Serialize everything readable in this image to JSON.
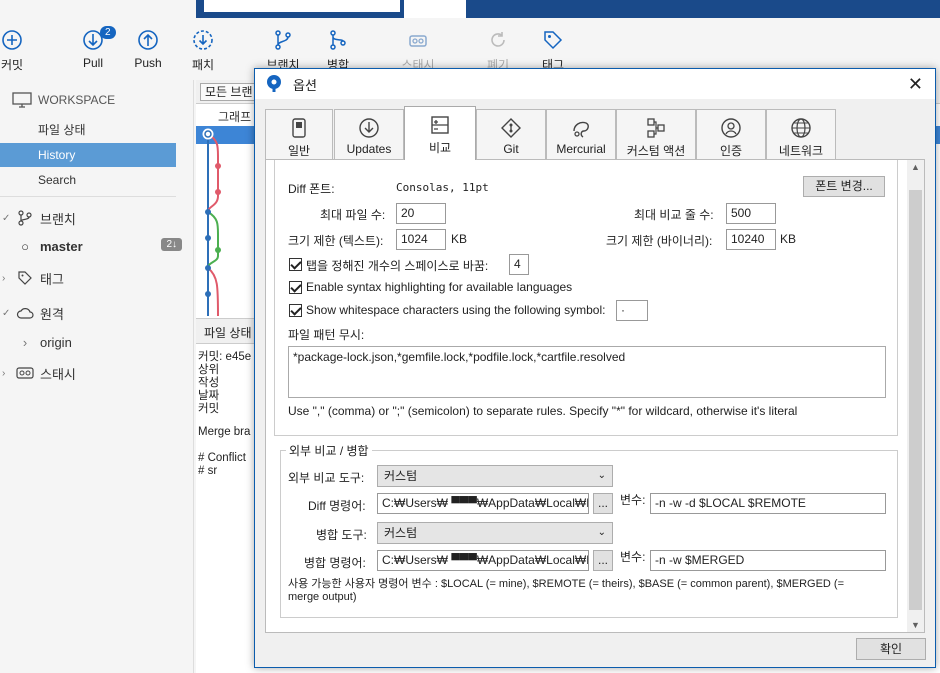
{
  "toolbar": {
    "commit": "커밋",
    "pull": "Pull",
    "pull_badge": "2",
    "push": "Push",
    "fetch": "패치",
    "branch": "브랜치",
    "merge": "병합",
    "stash": "스태시",
    "discard": "폐기",
    "tag": "태그"
  },
  "sidebar": {
    "workspace": "WORKSPACE",
    "items": [
      {
        "label": "파일 상태"
      },
      {
        "label": "History"
      },
      {
        "label": "Search"
      }
    ],
    "branches": "브랜치",
    "master": "master",
    "master_badge": "2↓",
    "tags": "태그",
    "remotes": "원격",
    "origin": "origin",
    "stashes": "스태시"
  },
  "main": {
    "filter_button": "모든 브랜",
    "graph_header": "그래프",
    "lower_tab": "파일 상태",
    "commit_line": "커밋: e45e",
    "parent_line": "상위",
    "author_line": "작성",
    "date_line": "날짜",
    "committer_line": "커밋",
    "merge_text": "Merge bra",
    "conflict_text": "# Conflict",
    "conflict_file": "#      sr"
  },
  "dialog": {
    "title": "옵션",
    "close": "✕",
    "tabs": [
      {
        "label": "일반"
      },
      {
        "label": "Updates"
      },
      {
        "label": "비교"
      },
      {
        "label": "Git"
      },
      {
        "label": "Mercurial"
      },
      {
        "label": "커스텀 액션"
      },
      {
        "label": "인증"
      },
      {
        "label": "네트워크"
      }
    ],
    "diff": {
      "font_label": "Diff 폰트:",
      "font_value": "Consolas, 11pt",
      "font_button": "폰트 변경...",
      "max_files_label": "최대 파일 수:",
      "max_files_value": "20",
      "max_lines_label": "최대 비교 줄 수:",
      "max_lines_value": "500",
      "size_text_label": "크기 제한 (텍스트):",
      "size_text_value": "1024",
      "size_text_unit": "KB",
      "size_bin_label": "크기 제한 (바이너리):",
      "size_bin_value": "10240",
      "size_bin_unit": "KB",
      "tabs_spaces_label": "탭을 정해진 개수의 스페이스로 바꿈:",
      "tabs_spaces_value": "4",
      "syntax_label": "Enable syntax highlighting for available languages",
      "whitespace_label": "Show whitespace characters using the following symbol:",
      "whitespace_value": "·",
      "ignore_label": "파일 패턴 무시:",
      "ignore_value": "*package-lock.json,*gemfile.lock,*podfile.lock,*cartfile.resolved",
      "ignore_hint": "Use \",\" (comma) or \";\" (semicolon) to separate rules. Specify \"*\" for wildcard, otherwise it's literal"
    },
    "external": {
      "group_title": "외부 비교 / 병합",
      "diff_tool_label": "외부 비교 도구:",
      "diff_tool_value": "커스텀",
      "diff_cmd_label": "Diff 명령어:",
      "diff_cmd_value": "C:₩Users₩ ▀▀▀₩AppData₩Local₩Pro",
      "diff_args_label": "변수:",
      "diff_args_value": "-n -w -d $LOCAL $REMOTE",
      "merge_tool_label": "병합 도구:",
      "merge_tool_value": "커스텀",
      "merge_cmd_label": "병합 명령어:",
      "merge_cmd_value": "C:₩Users₩ ▀▀▀₩AppData₩Local₩Pro",
      "merge_args_label": "변수:",
      "merge_args_value": "-n -w $MERGED",
      "browse": "...",
      "vars_hint": "사용 가능한 사용자 명령어 변수 : $LOCAL (= mine), $REMOTE (= theirs), $BASE (= common parent), $MERGED (= merge output)"
    },
    "ok_button": "확인"
  }
}
